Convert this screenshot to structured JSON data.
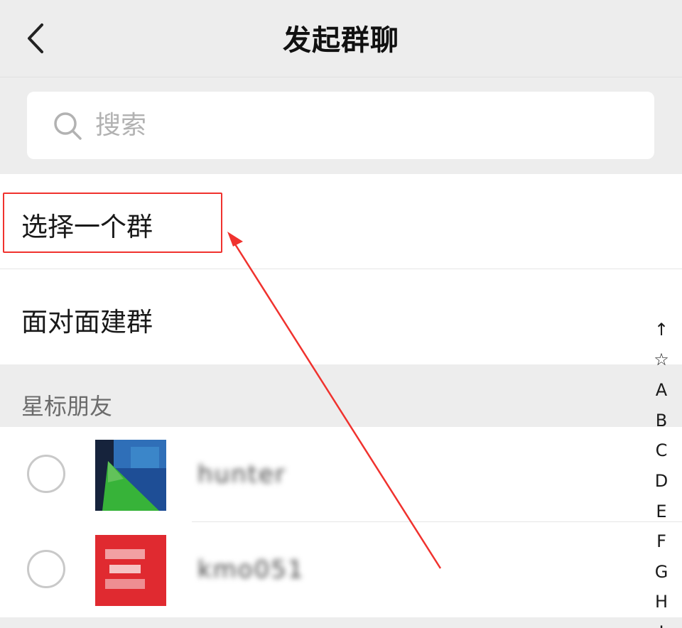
{
  "header": {
    "title": "发起群聊"
  },
  "search": {
    "placeholder": "搜索"
  },
  "menu": {
    "items": [
      {
        "label": "选择一个群"
      },
      {
        "label": "面对面建群"
      }
    ]
  },
  "section": {
    "label": "星标朋友"
  },
  "contacts": [
    {
      "name": "hunter",
      "selected": false,
      "avatar": "blurred-blue-green-avatar"
    },
    {
      "name": "kmo051",
      "selected": false,
      "avatar": "blurred-red-avatar"
    }
  ],
  "index_bar": {
    "items": [
      "↑",
      "☆",
      "A",
      "B",
      "C",
      "D",
      "E",
      "F",
      "G",
      "H",
      "I"
    ]
  },
  "annotation": {
    "highlight_color": "#f0322e",
    "arrow_color": "#f0322e"
  },
  "icons": {
    "back": "chevron-left-icon",
    "search": "search-icon"
  }
}
